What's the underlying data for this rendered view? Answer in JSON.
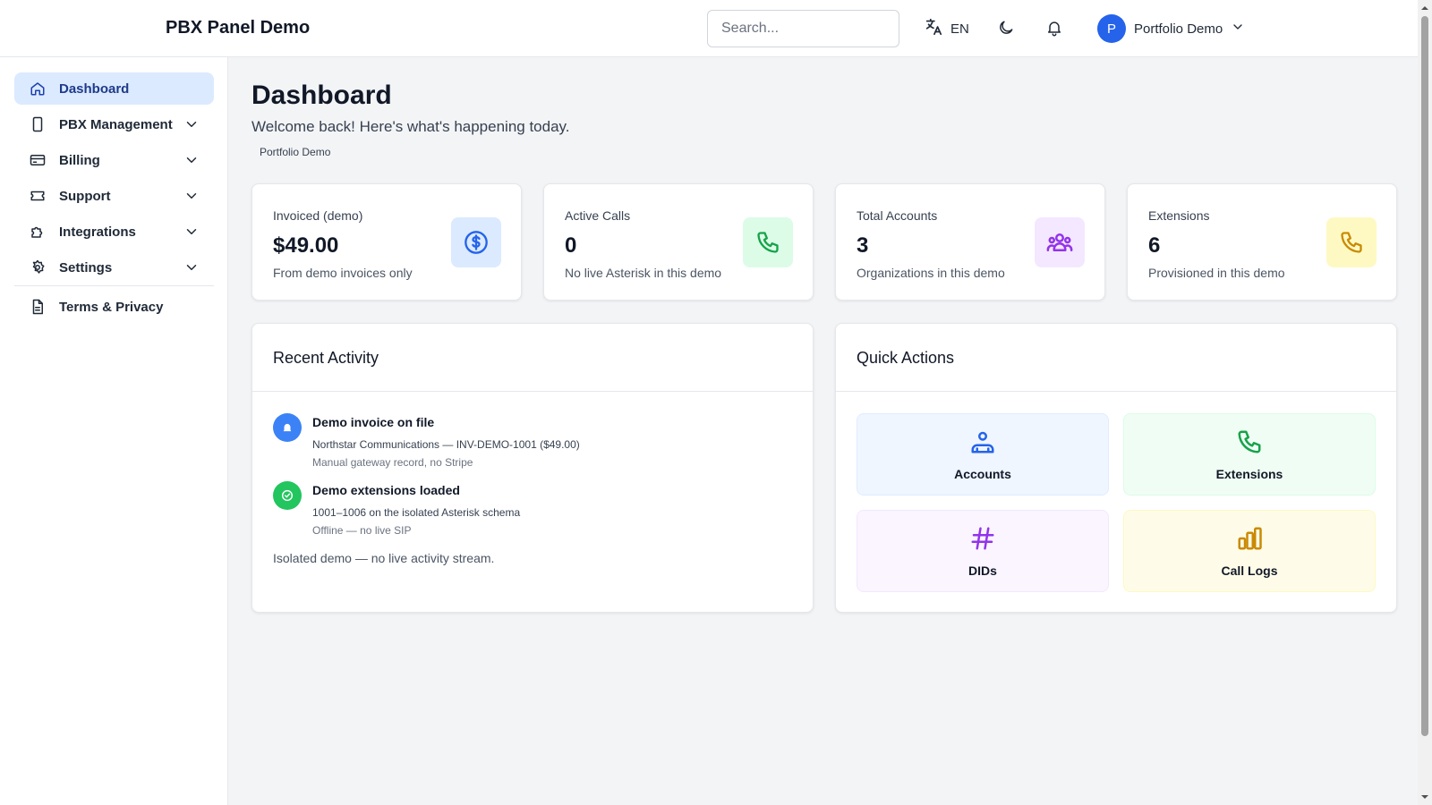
{
  "header": {
    "title": "PBX Panel Demo",
    "search_placeholder": "Search...",
    "language": "EN",
    "user": {
      "initial": "P",
      "name": "Portfolio Demo"
    }
  },
  "sidebar": {
    "items": [
      {
        "label": "Dashboard",
        "icon": "home-icon",
        "active": true
      },
      {
        "label": "PBX Management",
        "icon": "device-icon",
        "expandable": true
      },
      {
        "label": "Billing",
        "icon": "credit-card-icon",
        "expandable": true
      },
      {
        "label": "Support",
        "icon": "ticket-icon",
        "expandable": true
      },
      {
        "label": "Integrations",
        "icon": "puzzle-icon",
        "expandable": true
      },
      {
        "label": "Settings",
        "icon": "gear-icon",
        "expandable": true
      },
      {
        "label": "Terms & Privacy",
        "icon": "document-icon"
      }
    ]
  },
  "page": {
    "title": "Dashboard",
    "subtitle": "Welcome back! Here's what's happening today.",
    "organization": "Portfolio Demo"
  },
  "stats": [
    {
      "label": "Invoiced (demo)",
      "value": "$49.00",
      "note": "From demo invoices only",
      "icon": "dollar-icon",
      "color": "#2563eb",
      "bg": "#dbeafe"
    },
    {
      "label": "Active Calls",
      "value": "0",
      "note": "No live Asterisk in this demo",
      "icon": "phone-icon",
      "color": "#16a34a",
      "bg": "#dcfce7"
    },
    {
      "label": "Total Accounts",
      "value": "3",
      "note": "Organizations in this demo",
      "icon": "users-icon",
      "color": "#9333ea",
      "bg": "#f3e8ff"
    },
    {
      "label": "Extensions",
      "value": "6",
      "note": "Provisioned in this demo",
      "icon": "phone-icon",
      "color": "#ca8a04",
      "bg": "#fef9c3"
    }
  ],
  "recent_activity": {
    "title": "Recent Activity",
    "items": [
      {
        "title": "Demo invoice on file",
        "detail": "Northstar Communications — INV-DEMO-1001 ($49.00)",
        "meta": "Manual gateway record, no Stripe",
        "icon": "bell-icon",
        "color": "#3b82f6"
      },
      {
        "title": "Demo extensions loaded",
        "detail": "1001–1006 on the isolated Asterisk schema",
        "meta": "Offline — no live SIP",
        "icon": "check-icon",
        "color": "#22c55e"
      }
    ],
    "footnote": "Isolated demo — no live activity stream."
  },
  "quick_actions": {
    "title": "Quick Actions",
    "items": [
      {
        "label": "Accounts",
        "icon": "accounts-icon",
        "color": "#2563eb",
        "bg": "#eff6ff"
      },
      {
        "label": "Extensions",
        "icon": "phone-icon",
        "color": "#16a34a",
        "bg": "#f0fdf4"
      },
      {
        "label": "DIDs",
        "icon": "hash-icon",
        "color": "#9333ea",
        "bg": "#faf5ff"
      },
      {
        "label": "Call Logs",
        "icon": "bar-chart-icon",
        "color": "#ca8a04",
        "bg": "#fefce8"
      }
    ]
  }
}
